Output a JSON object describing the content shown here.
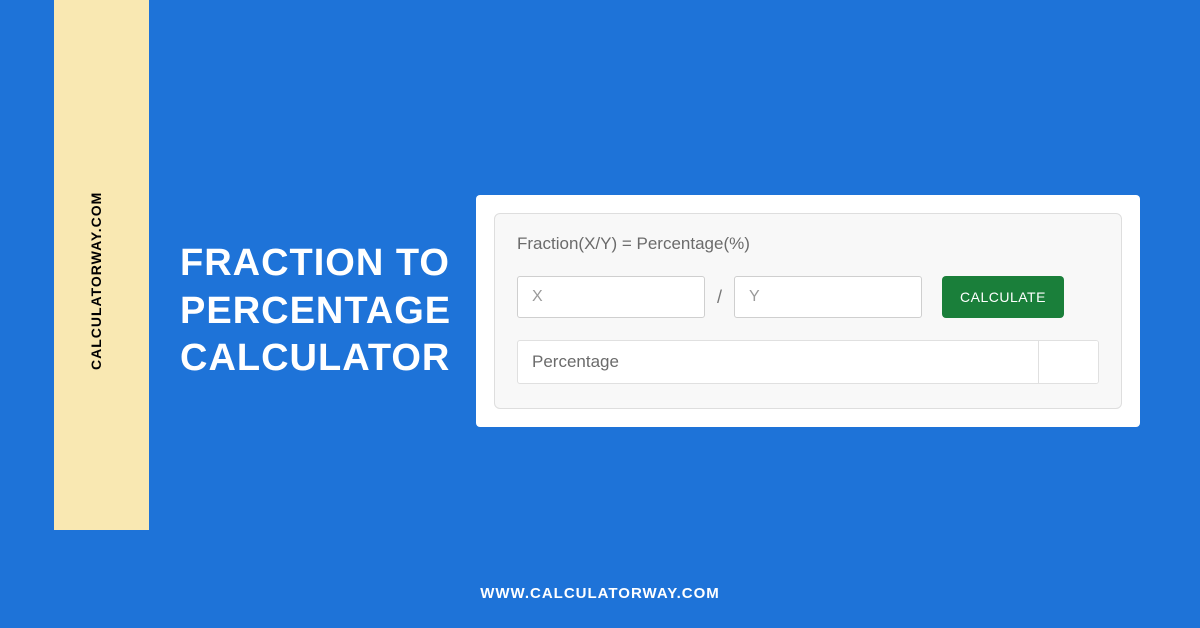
{
  "brand": {
    "vertical_text": "CALCULATORWAY.COM",
    "footer_url": "WWW.CALCULATORWAY.COM"
  },
  "title": {
    "line1": "FRACTION TO",
    "line2": "PERCENTAGE",
    "line3": "CALCULATOR"
  },
  "calculator": {
    "formula_label": "Fraction(X/Y) = Percentage(%)",
    "x_placeholder": "X",
    "y_placeholder": "Y",
    "slash": "/",
    "calculate_label": "CALCULATE",
    "result_label": "Percentage",
    "result_value": ""
  }
}
